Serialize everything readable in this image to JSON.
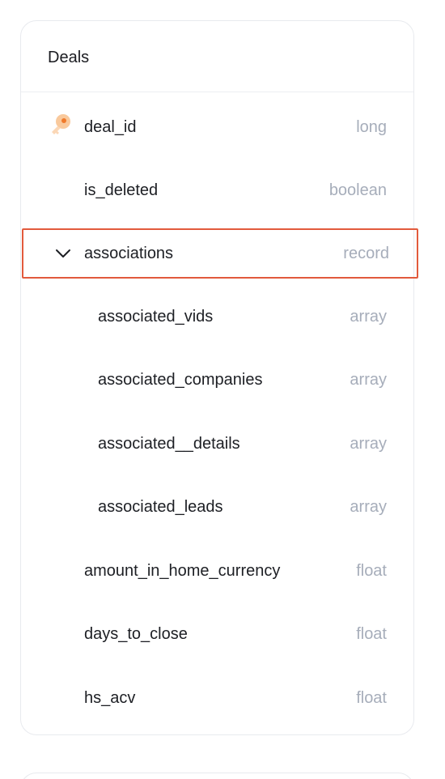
{
  "card": {
    "title": "Deals"
  },
  "fields": [
    {
      "name": "deal_id",
      "type": "long",
      "icon": "primary-key-icon"
    },
    {
      "name": "is_deleted",
      "type": "boolean"
    },
    {
      "name": "associations",
      "type": "record",
      "expanded": true,
      "selected": true,
      "icon": "chevron-down-icon"
    },
    {
      "name": "associated_vids",
      "type": "array",
      "nested": true
    },
    {
      "name": "associated_companies",
      "type": "array",
      "nested": true
    },
    {
      "name": "associated__details",
      "type": "array",
      "nested": true
    },
    {
      "name": "associated_leads",
      "type": "array",
      "nested": true
    },
    {
      "name": "amount_in_home_currency",
      "type": "float"
    },
    {
      "name": "days_to_close",
      "type": "float"
    },
    {
      "name": "hs_acv",
      "type": "float"
    }
  ],
  "colors": {
    "selection_border": "#e25a3c",
    "type_text": "#a6adba",
    "key_icon": "#f7c08f"
  }
}
